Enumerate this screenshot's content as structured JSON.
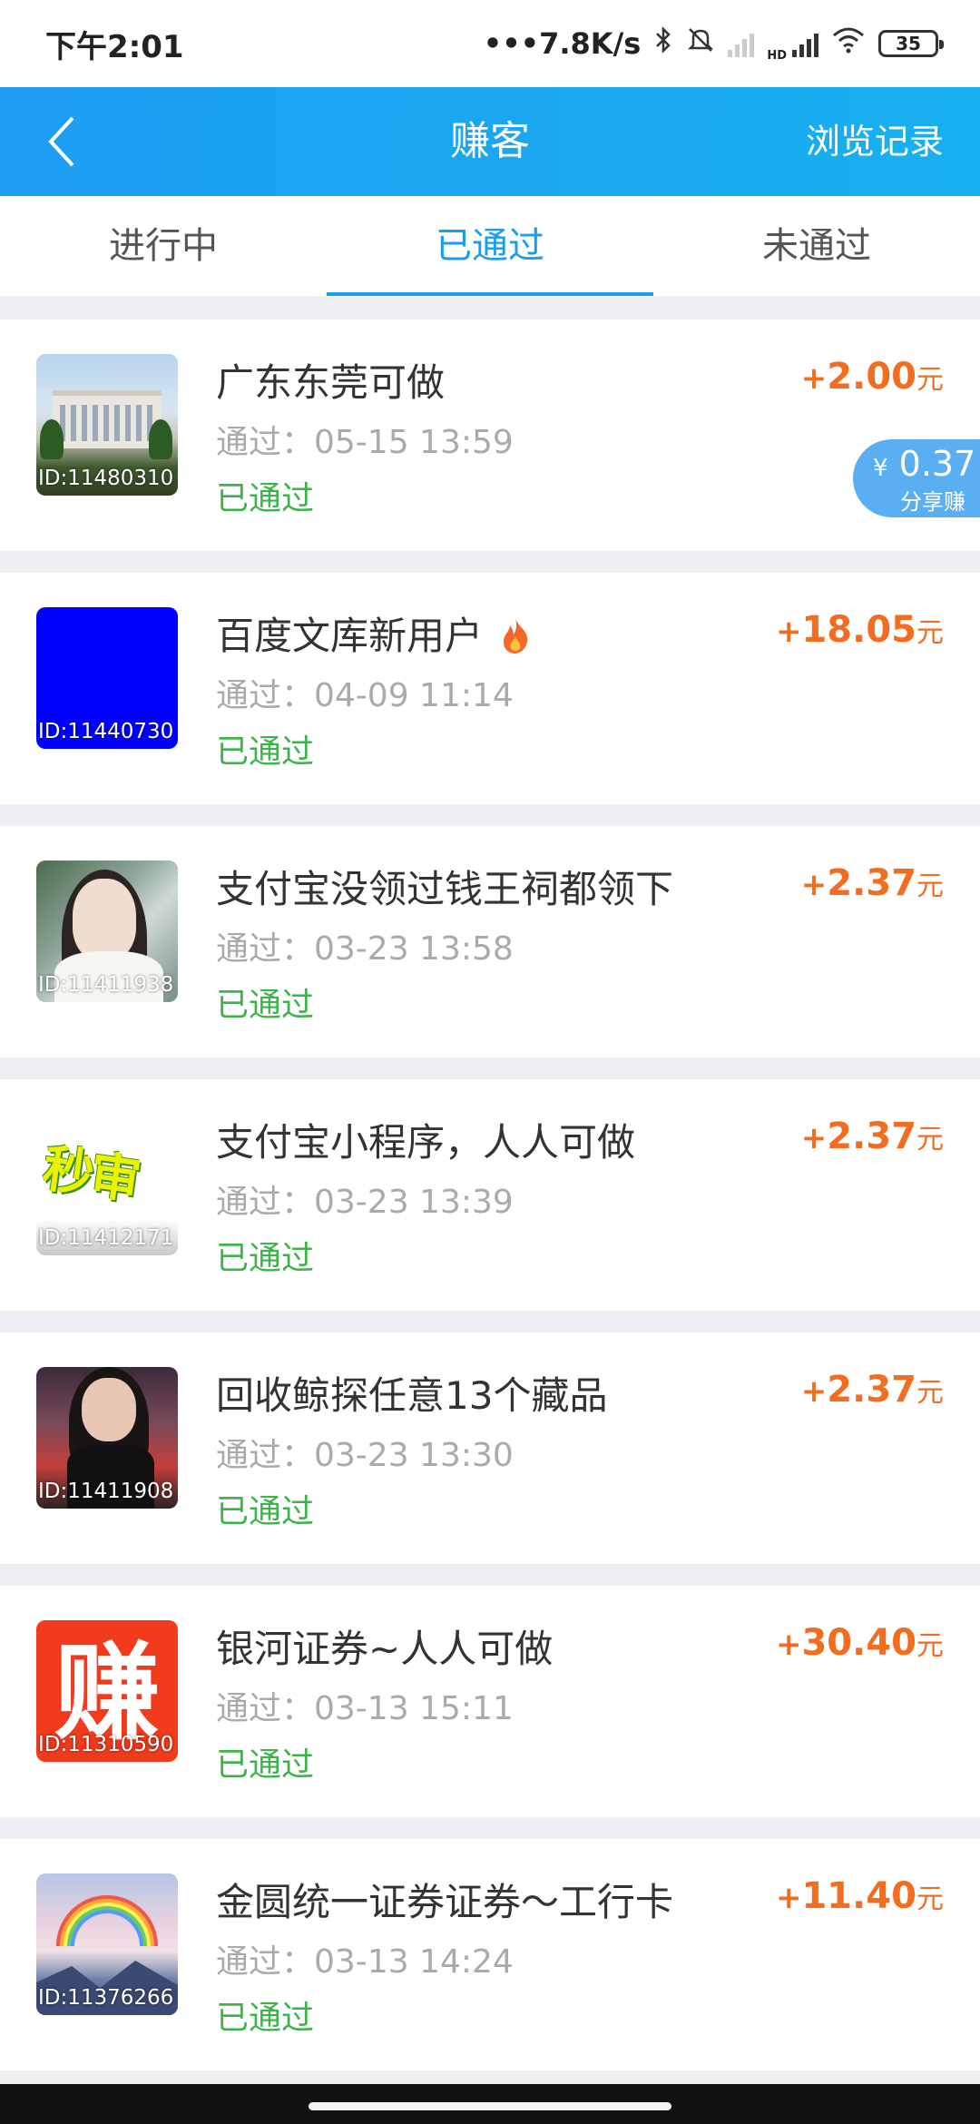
{
  "status_bar": {
    "time": "下午2:01",
    "speed": "7.8K/s",
    "hd": "HD",
    "battery": "35",
    "icons": [
      "bluetooth-icon",
      "mute-icon",
      "signal-icon",
      "wifi-icon",
      "battery-icon"
    ]
  },
  "header": {
    "title": "赚客",
    "history": "浏览记录",
    "back_icon": "chevron-left-icon",
    "bg_color": "#1ea4f2"
  },
  "tabs": [
    {
      "label": "进行中",
      "active": false
    },
    {
      "label": "已通过",
      "active": true
    },
    {
      "label": "未通过",
      "active": false
    }
  ],
  "items": [
    {
      "title": "广东东莞可做",
      "time": "通过：05-15 13:59",
      "status": "已通过",
      "plus": "+",
      "amount": "2.00",
      "unit": "元",
      "id": "ID:11480310"
    },
    {
      "title": "百度文库新用户",
      "time": "通过：04-09 11:14",
      "status": "已通过",
      "plus": "+",
      "amount": "18.05",
      "unit": "元",
      "id": "ID:11440730"
    },
    {
      "title": "支付宝没领过钱王祠都领下",
      "time": "通过：03-23 13:58",
      "status": "已通过",
      "plus": "+",
      "amount": "2.37",
      "unit": "元",
      "id": "ID:11411938"
    },
    {
      "title": "支付宝小程序，人人可做",
      "time": "通过：03-23 13:39",
      "status": "已通过",
      "plus": "+",
      "amount": "2.37",
      "unit": "元",
      "id": "ID:11412171",
      "thumb_text": "秒审"
    },
    {
      "title": "回收鲸探任意13个藏品",
      "time": "通过：03-23 13:30",
      "status": "已通过",
      "plus": "+",
      "amount": "2.37",
      "unit": "元",
      "id": "ID:11411908"
    },
    {
      "title": "银河证券~人人可做",
      "time": "通过：03-13 15:11",
      "status": "已通过",
      "plus": "+",
      "amount": "30.40",
      "unit": "元",
      "id": "ID:11310590",
      "thumb_text": "赚"
    },
    {
      "title": "金圆统一证券证券～工行卡",
      "time": "通过：03-13 14:24",
      "status": "已通过",
      "plus": "+",
      "amount": "11.40",
      "unit": "元",
      "id": "ID:11376266"
    }
  ],
  "share_badge": {
    "currency": "¥",
    "amount": "0.37",
    "label": "分享赚"
  },
  "colors": {
    "reward": "#f26d1f",
    "status": "#3cb44a",
    "active_tab": "#1a9ee8"
  }
}
